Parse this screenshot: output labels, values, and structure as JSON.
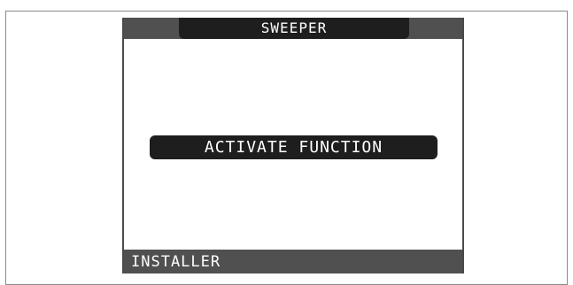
{
  "screen": {
    "title": "SWEEPER",
    "action_label": "ACTIVATE FUNCTION",
    "footer_label": "INSTALLER"
  },
  "colors": {
    "bar": "#505050",
    "dark": "#1e1e1e",
    "text_light": "#ffffff",
    "background": "#ffffff"
  }
}
